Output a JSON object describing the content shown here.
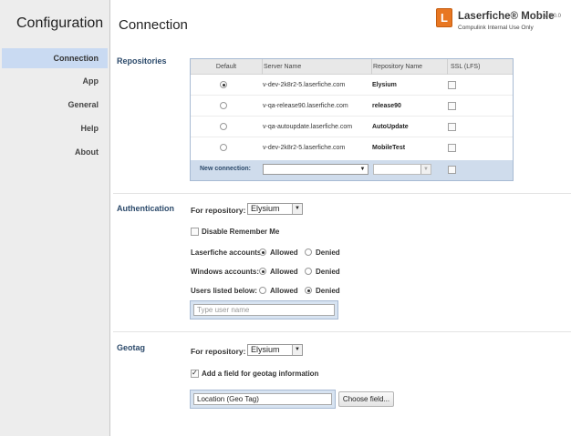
{
  "sidebar": {
    "title": "Configuration",
    "items": [
      {
        "label": "Connection",
        "active": true
      },
      {
        "label": "App"
      },
      {
        "label": "General"
      },
      {
        "label": "Help"
      },
      {
        "label": "About"
      }
    ]
  },
  "page": {
    "title": "Connection"
  },
  "logo": {
    "letter": "L",
    "name": "Laserfiche® Mobile",
    "version": "v 9.0.0",
    "subtitle": "Compulink Internal Use Only",
    "brand_color": "#e87722"
  },
  "repositories": {
    "section_label": "Repositories",
    "columns": [
      "Default",
      "Server Name",
      "Repository Name",
      "SSL (LFS)"
    ],
    "rows": [
      {
        "default": true,
        "server": "v-dev-2k8r2-5.laserfiche.com",
        "repo": "Elysium",
        "ssl": false
      },
      {
        "default": false,
        "server": "v-qa-release90.laserfiche.com",
        "repo": "release90",
        "ssl": false
      },
      {
        "default": false,
        "server": "v-qa-autoupdate.laserfiche.com",
        "repo": "AutoUpdate",
        "ssl": false
      },
      {
        "default": false,
        "server": "v-dev-2k8r2-5.laserfiche.com",
        "repo": "MobileTest",
        "ssl": false
      }
    ],
    "new_connection_label": "New connection:",
    "new_server_value": "",
    "new_repo_value": ""
  },
  "authentication": {
    "section_label": "Authentication",
    "for_repository_label": "For repository:",
    "repository_value": "Elysium",
    "disable_remember_label": "Disable Remember Me",
    "disable_remember_checked": false,
    "laserfiche_label": "Laserfiche accounts:",
    "windows_label": "Windows accounts:",
    "users_label": "Users listed below:",
    "allowed_label": "Allowed",
    "denied_label": "Denied",
    "laserfiche_value": "allowed",
    "windows_value": "allowed",
    "users_value": "denied",
    "username_placeholder": "Type user name"
  },
  "geotag": {
    "section_label": "Geotag",
    "for_repository_label": "For repository:",
    "repository_value": "Elysium",
    "add_field_label": "Add a field for geotag information",
    "add_field_checked": true,
    "field_value": "Location (Geo Tag)",
    "choose_button": "Choose field..."
  },
  "icons": {
    "dropdown": "chevron-down-icon",
    "radio": "radio-button",
    "checkbox": "checkbox"
  }
}
